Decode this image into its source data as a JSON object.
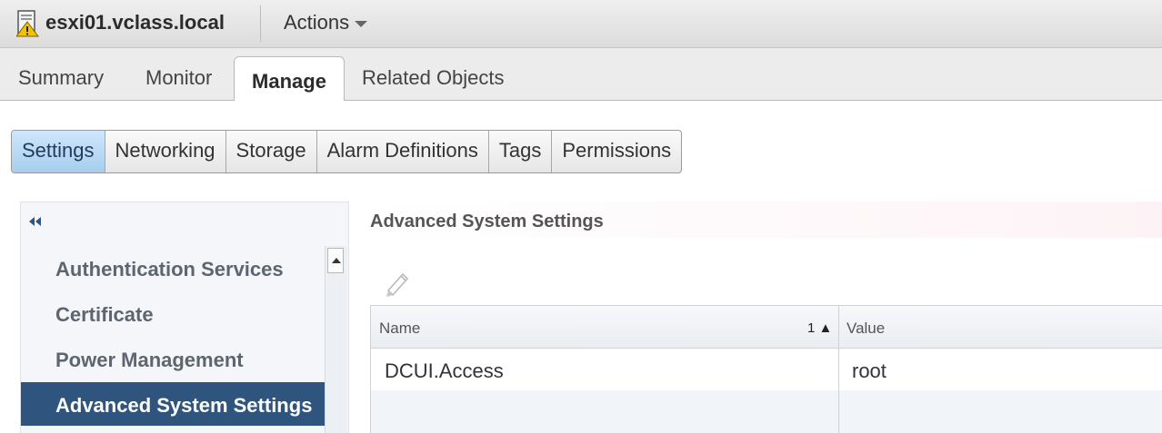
{
  "header": {
    "host_name": "esxi01.vclass.local",
    "host_icon": "host-warning-icon",
    "actions_label": "Actions",
    "warning_color": "#f2c300"
  },
  "tabs": [
    {
      "label": "Summary",
      "active": false
    },
    {
      "label": "Monitor",
      "active": false
    },
    {
      "label": "Manage",
      "active": true
    },
    {
      "label": "Related Objects",
      "active": false
    }
  ],
  "subtabs": [
    {
      "label": "Settings",
      "selected": true
    },
    {
      "label": "Networking",
      "selected": false
    },
    {
      "label": "Storage",
      "selected": false
    },
    {
      "label": "Alarm Definitions",
      "selected": false
    },
    {
      "label": "Tags",
      "selected": false
    },
    {
      "label": "Permissions",
      "selected": false
    }
  ],
  "sidebar": {
    "items": [
      {
        "label": "Authentication Services",
        "selected": false
      },
      {
        "label": "Certificate",
        "selected": false
      },
      {
        "label": "Power Management",
        "selected": false
      },
      {
        "label": "Advanced System Settings",
        "selected": true
      }
    ],
    "selected_color": "#2f557f"
  },
  "content": {
    "title": "Advanced System Settings",
    "grid": {
      "columns": [
        "Name",
        "Value"
      ],
      "sort_indicator": "1 ▲",
      "rows": [
        {
          "name": "DCUI.Access",
          "value": "root"
        }
      ]
    }
  }
}
